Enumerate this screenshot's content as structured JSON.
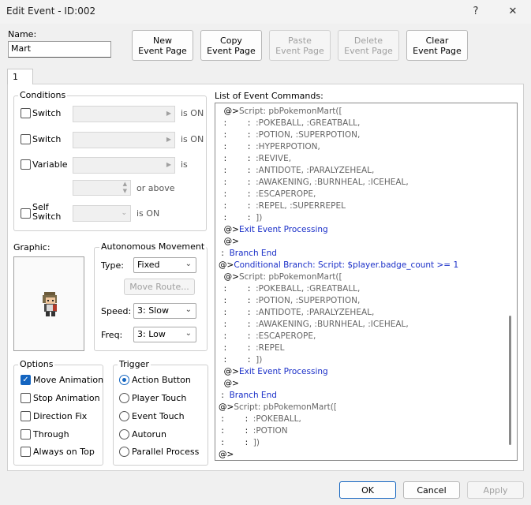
{
  "window": {
    "title": "Edit Event - ID:002",
    "help": "?",
    "close": "✕"
  },
  "name": {
    "label": "Name:",
    "value": "Mart"
  },
  "toolbar": {
    "new_page": "New\nEvent Page",
    "copy_page": "Copy\nEvent Page",
    "paste_page": "Paste\nEvent Page",
    "delete_page": "Delete\nEvent Page",
    "clear_page": "Clear\nEvent Page"
  },
  "tabs": [
    {
      "label": "1"
    }
  ],
  "conditions": {
    "title": "Conditions",
    "switch1": {
      "label": "Switch",
      "suffix": "is ON"
    },
    "switch2": {
      "label": "Switch",
      "suffix": "is ON"
    },
    "variable": {
      "label": "Variable",
      "suffix": "is",
      "or_above": "or above"
    },
    "self_switch": {
      "label": "Self\nSwitch",
      "suffix": "is ON"
    }
  },
  "graphic": {
    "label": "Graphic:"
  },
  "autonomous": {
    "title": "Autonomous Movement",
    "type_label": "Type:",
    "type_value": "Fixed",
    "move_route": "Move Route...",
    "speed_label": "Speed:",
    "speed_value": "3: Slow",
    "freq_label": "Freq:",
    "freq_value": "3: Low"
  },
  "options": {
    "title": "Options",
    "items": [
      {
        "label": "Move Animation",
        "checked": true
      },
      {
        "label": "Stop Animation",
        "checked": false
      },
      {
        "label": "Direction Fix",
        "checked": false
      },
      {
        "label": "Through",
        "checked": false
      },
      {
        "label": "Always on Top",
        "checked": false
      }
    ]
  },
  "trigger": {
    "title": "Trigger",
    "items": [
      {
        "label": "Action Button",
        "selected": true
      },
      {
        "label": "Player Touch",
        "selected": false
      },
      {
        "label": "Event Touch",
        "selected": false
      },
      {
        "label": "Autorun",
        "selected": false
      },
      {
        "label": "Parallel Process",
        "selected": false
      }
    ]
  },
  "commands": {
    "title": "List of Event Commands:",
    "lines": [
      {
        "prefix": "  @>",
        "text": "Script: pbPokemonMart([",
        "style": "script"
      },
      {
        "prefix": "  :        :  ",
        "text": ":POKEBALL, :GREATBALL,",
        "style": "script"
      },
      {
        "prefix": "  :        :  ",
        "text": ":POTION, :SUPERPOTION,",
        "style": "script"
      },
      {
        "prefix": "  :        :  ",
        "text": ":HYPERPOTION,",
        "style": "script"
      },
      {
        "prefix": "  :        :  ",
        "text": ":REVIVE,",
        "style": "script"
      },
      {
        "prefix": "  :        :  ",
        "text": ":ANTIDOTE, :PARALYZEHEAL,",
        "style": "script"
      },
      {
        "prefix": "  :        :  ",
        "text": ":AWAKENING, :BURNHEAL, :ICEHEAL,",
        "style": "script"
      },
      {
        "prefix": "  :        :  ",
        "text": ":ESCAPEROPE,",
        "style": "script"
      },
      {
        "prefix": "  :        :  ",
        "text": ":REPEL, :SUPERREPEL",
        "style": "script"
      },
      {
        "prefix": "  :        :  ",
        "text": "])",
        "style": "script"
      },
      {
        "prefix": "  @>",
        "text": "Exit Event Processing",
        "style": "blue"
      },
      {
        "prefix": "  @>",
        "text": "",
        "style": "script"
      },
      {
        "prefix": " :  ",
        "text": "Branch End",
        "style": "blue"
      },
      {
        "prefix": "@>",
        "text": "Conditional Branch: Script: $player.badge_count >= 1",
        "style": "blue"
      },
      {
        "prefix": "  @>",
        "text": "Script: pbPokemonMart([",
        "style": "script"
      },
      {
        "prefix": "  :        :  ",
        "text": ":POKEBALL, :GREATBALL,",
        "style": "script"
      },
      {
        "prefix": "  :        :  ",
        "text": ":POTION, :SUPERPOTION,",
        "style": "script"
      },
      {
        "prefix": "  :        :  ",
        "text": ":ANTIDOTE, :PARALYZEHEAL,",
        "style": "script"
      },
      {
        "prefix": "  :        :  ",
        "text": ":AWAKENING, :BURNHEAL, :ICEHEAL,",
        "style": "script"
      },
      {
        "prefix": "  :        :  ",
        "text": ":ESCAPEROPE,",
        "style": "script"
      },
      {
        "prefix": "  :        :  ",
        "text": ":REPEL",
        "style": "script"
      },
      {
        "prefix": "  :        :  ",
        "text": "])",
        "style": "script"
      },
      {
        "prefix": "  @>",
        "text": "Exit Event Processing",
        "style": "blue"
      },
      {
        "prefix": "  @>",
        "text": "",
        "style": "script"
      },
      {
        "prefix": " :  ",
        "text": "Branch End",
        "style": "blue"
      },
      {
        "prefix": "@>",
        "text": "Script: pbPokemonMart([",
        "style": "script"
      },
      {
        "prefix": " :        :  ",
        "text": ":POKEBALL,",
        "style": "script"
      },
      {
        "prefix": " :        :  ",
        "text": ":POTION",
        "style": "script"
      },
      {
        "prefix": " :        :  ",
        "text": "])",
        "style": "script"
      },
      {
        "prefix": "@>",
        "text": "",
        "style": "script"
      }
    ]
  },
  "footer": {
    "ok": "OK",
    "cancel": "Cancel",
    "apply": "Apply"
  }
}
